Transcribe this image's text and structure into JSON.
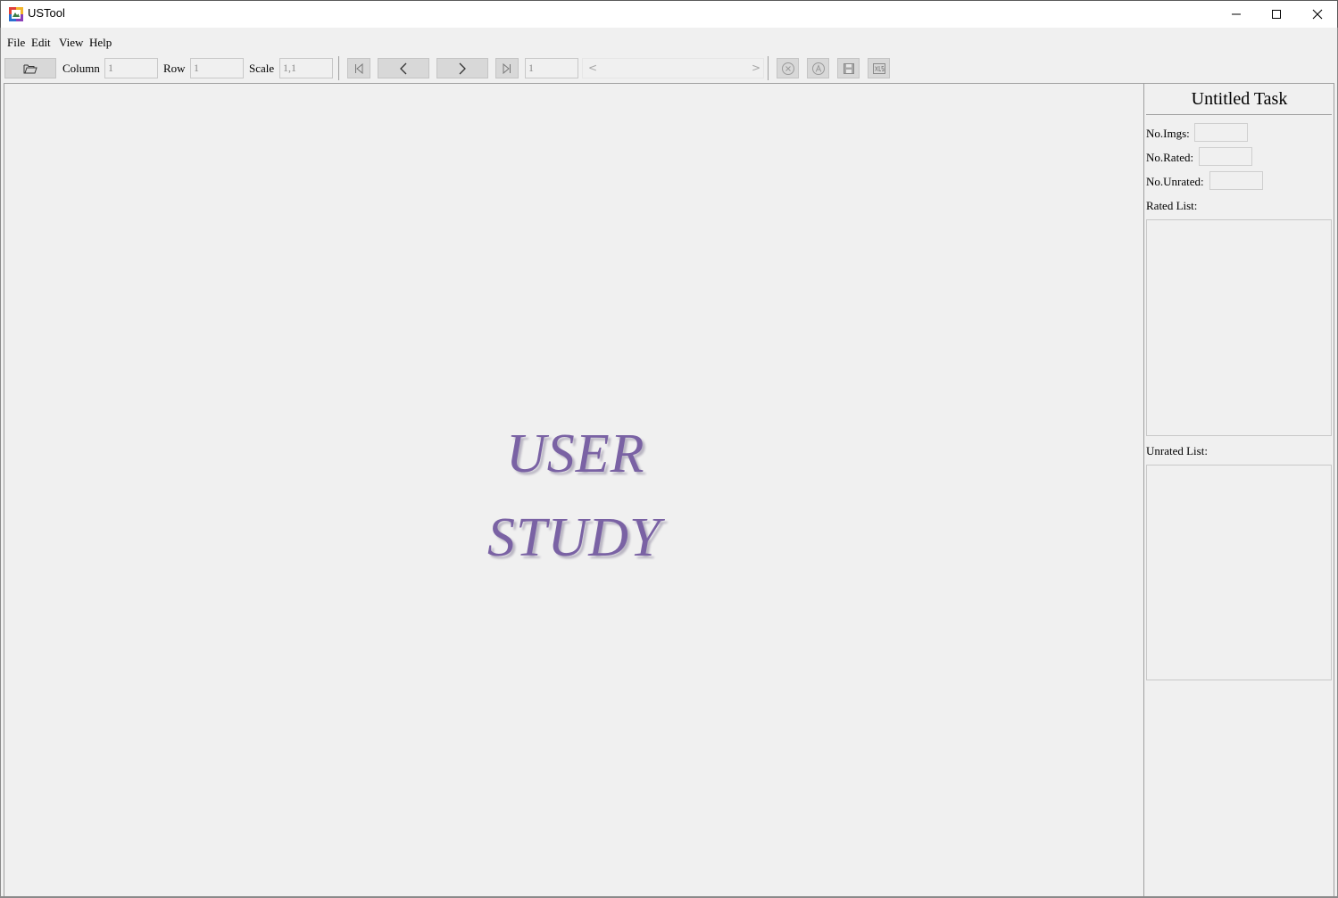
{
  "window": {
    "title": "USTool",
    "controls": [
      "minimize-icon",
      "maximize-icon",
      "close-icon"
    ]
  },
  "menu": {
    "items": [
      "File",
      "Edit",
      "View",
      "Help"
    ]
  },
  "toolbar": {
    "open_icon": "folder-open-icon",
    "column_label": "Column",
    "column_value": "1",
    "row_label": "Row",
    "row_value": "1",
    "scale_label": "Scale",
    "scale_value": "1,1",
    "nav_icons": [
      "first-page-icon",
      "prev-icon",
      "next-icon",
      "last-page-icon"
    ],
    "page_value": "1",
    "scroll_left": "<",
    "scroll_right": ">",
    "action_icons": [
      "clear-icon",
      "auto-icon",
      "save-icon",
      "export-xls-icon"
    ]
  },
  "canvas": {
    "logo_line1": "USER",
    "logo_line2": "STUDY",
    "logo_color": "#7a62a4"
  },
  "panel": {
    "task_title": "Untitled Task",
    "no_imgs_label": "No.Imgs:",
    "no_imgs_value": "",
    "no_rated_label": "No.Rated:",
    "no_rated_value": "",
    "no_unrated_label": "No.Unrated:",
    "no_unrated_value": "",
    "rated_list_label": "Rated List:",
    "rated_list": [],
    "unrated_list_label": "Unrated List:",
    "unrated_list": []
  }
}
